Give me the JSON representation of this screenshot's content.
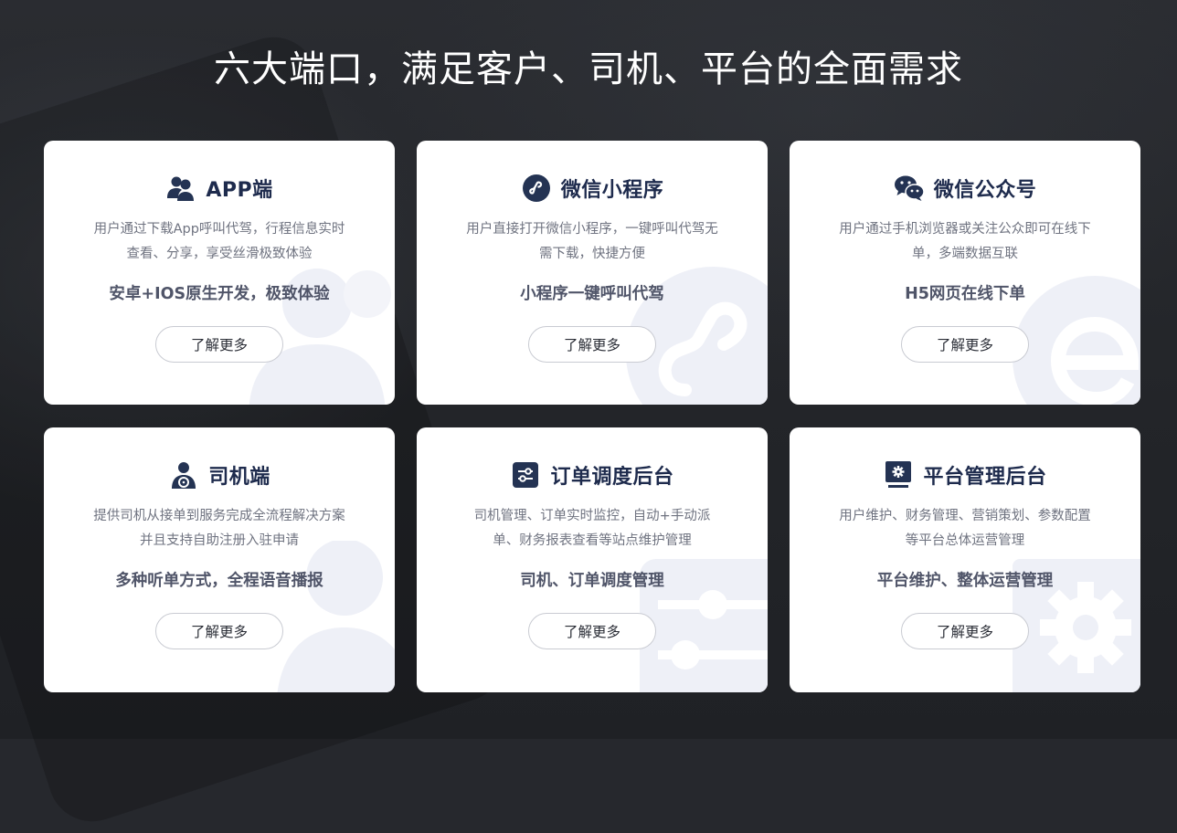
{
  "page": {
    "title": "六大端口，满足客户、司机、平台的全面需求"
  },
  "colors": {
    "background": "#26282d",
    "card": "#ffffff",
    "title_navy": "#1e2b4d",
    "icon_navy": "#243353",
    "text_gray": "#6f7380",
    "highlight_gray": "#505569",
    "watermark": "#eef0f7"
  },
  "cards": [
    {
      "icon": "users-icon",
      "title": "APP端",
      "desc_line1": "用户通过下载App呼叫代驾，行程信息实时",
      "desc_line2": "查看、分享，享受丝滑极致体验",
      "highlight": "安卓+IOS原生开发，极致体验",
      "button": "了解更多"
    },
    {
      "icon": "mini-program-icon",
      "title": "微信小程序",
      "desc_line1": "用户直接打开微信小程序，一键呼叫代驾无",
      "desc_line2": "需下载，快捷方便",
      "highlight": "小程序一键呼叫代驾",
      "button": "了解更多"
    },
    {
      "icon": "wechat-icon",
      "title": "微信公众号",
      "desc_line1": "用户通过手机浏览器或关注公众即可在线下",
      "desc_line2": "单，多端数据互联",
      "highlight": "H5网页在线下单",
      "button": "了解更多"
    },
    {
      "icon": "driver-icon",
      "title": "司机端",
      "desc_line1": "提供司机从接单到服务完成全流程解决方案",
      "desc_line2": "并且支持自助注册入驻申请",
      "highlight": "多种听单方式，全程语音播报",
      "button": "了解更多"
    },
    {
      "icon": "sliders-icon",
      "title": "订单调度后台",
      "desc_line1": "司机管理、订单实时监控，自动+手动派",
      "desc_line2": "单、财务报表查看等站点维护管理",
      "highlight": "司机、订单调度管理",
      "button": "了解更多"
    },
    {
      "icon": "admin-gear-icon",
      "title": "平台管理后台",
      "desc_line1": "用户维护、财务管理、营销策划、参数配置",
      "desc_line2": "等平台总体运营管理",
      "highlight": "平台维护、整体运营管理",
      "button": "了解更多"
    }
  ]
}
